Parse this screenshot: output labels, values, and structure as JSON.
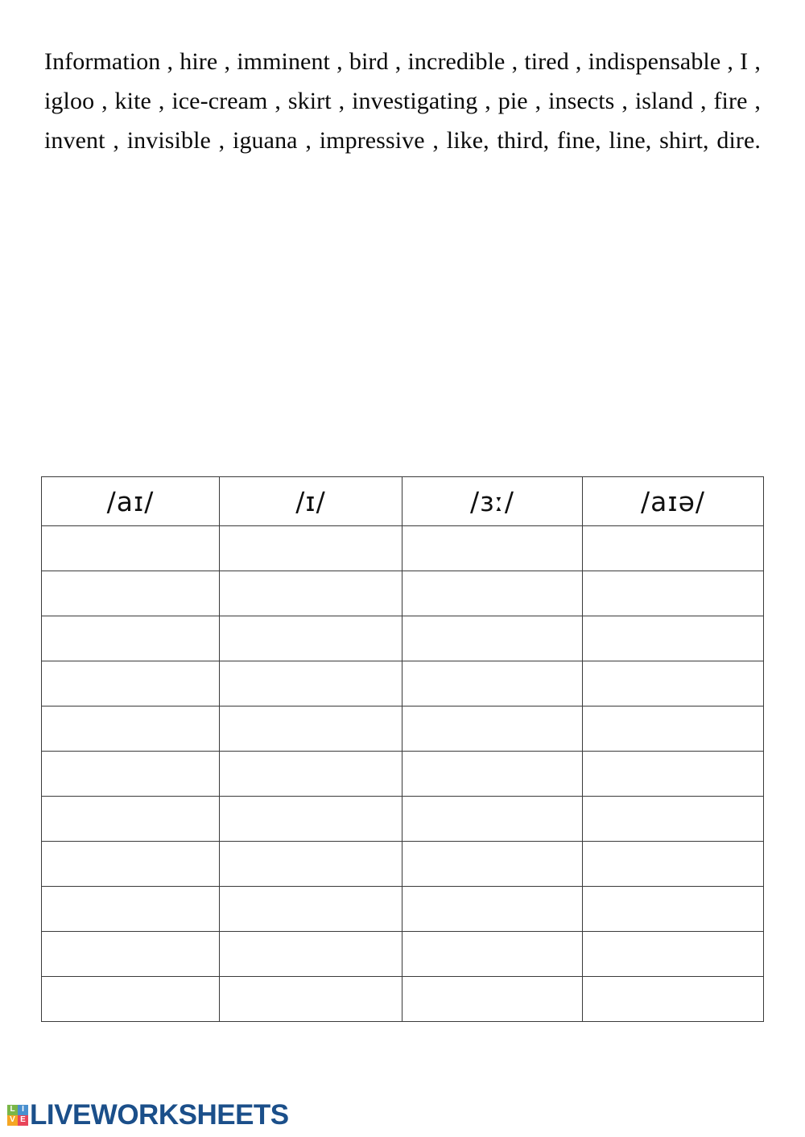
{
  "worksheet": {
    "word_bank": "Information , hire , imminent , bird , incredible , tired , indispensable , I , igloo , kite , ice-cream , skirt , investigating , pie , insects , island , fire , invent , invisible , iguana , impressive , like, third, fine, line, shirt, dire.",
    "table": {
      "headers": [
        "/aɪ/",
        "/ɪ/",
        "/ɜː/",
        "/aɪə/"
      ],
      "row_count": 11,
      "rows": [
        [
          "",
          "",
          "",
          ""
        ],
        [
          "",
          "",
          "",
          ""
        ],
        [
          "",
          "",
          "",
          ""
        ],
        [
          "",
          "",
          "",
          ""
        ],
        [
          "",
          "",
          "",
          ""
        ],
        [
          "",
          "",
          "",
          ""
        ],
        [
          "",
          "",
          "",
          ""
        ],
        [
          "",
          "",
          "",
          ""
        ],
        [
          "",
          "",
          "",
          ""
        ],
        [
          "",
          "",
          "",
          ""
        ],
        [
          "",
          "",
          "",
          ""
        ]
      ]
    }
  },
  "footer": {
    "brand_name": "LIVEWORKSHEETS",
    "logo_tiles": [
      "L",
      "I",
      "V",
      "E"
    ],
    "brand_color": "#1b4f8a"
  }
}
